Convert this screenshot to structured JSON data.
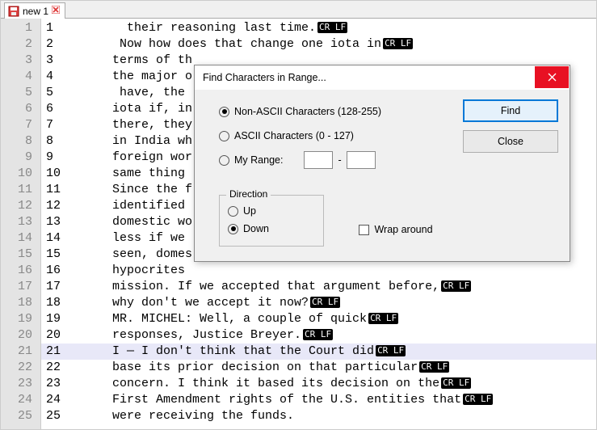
{
  "tab": {
    "title": "new 1"
  },
  "editor": {
    "eol_label": "CR LF",
    "highlight_index": 20,
    "lines": [
      {
        "n": 1,
        "c2": "1",
        "t": "    their reasoning last time.",
        "eol": true
      },
      {
        "n": 2,
        "c2": "2",
        "t": "   Now how does that change one iota in",
        "eol": true
      },
      {
        "n": 3,
        "c2": "3",
        "t": "  terms of th",
        "eol": false
      },
      {
        "n": 4,
        "c2": "4",
        "t": "  the major o",
        "eol": false
      },
      {
        "n": 5,
        "c2": "5",
        "t": "   have, the ",
        "eol": false
      },
      {
        "n": 6,
        "c2": "6",
        "t": "  iota if, in",
        "eol": false
      },
      {
        "n": 7,
        "c2": "7",
        "t": "  there, they",
        "eol": false
      },
      {
        "n": 8,
        "c2": "8",
        "t": "  in India wh",
        "eol": false
      },
      {
        "n": 9,
        "c2": "9",
        "t": "  foreign wor",
        "eol": false
      },
      {
        "n": 10,
        "c2": "10",
        "t": "  same thing ",
        "eol": false
      },
      {
        "n": 11,
        "c2": "11",
        "t": "  Since the f",
        "eol": false
      },
      {
        "n": 12,
        "c2": "12",
        "t": "  identified ",
        "eol": false
      },
      {
        "n": 13,
        "c2": "13",
        "t": "  domestic wo",
        "eol": false
      },
      {
        "n": 14,
        "c2": "14",
        "t": "  less if we ",
        "eol": false
      },
      {
        "n": 15,
        "c2": "15",
        "t": "  seen, domes",
        "eol": false
      },
      {
        "n": 16,
        "c2": "16",
        "t": "  hypocrites ",
        "eol": false
      },
      {
        "n": 17,
        "c2": "17",
        "t": "  mission. If we accepted that argument before,",
        "eol": true
      },
      {
        "n": 18,
        "c2": "18",
        "t": "  why don't we accept it now?",
        "eol": true
      },
      {
        "n": 19,
        "c2": "19",
        "t": "  MR. MICHEL: Well, a couple of quick",
        "eol": true
      },
      {
        "n": 20,
        "c2": "20",
        "t": "  responses, Justice Breyer.",
        "eol": true
      },
      {
        "n": 21,
        "c2": "21",
        "t": "  I — I don't think that the Court did",
        "eol": true
      },
      {
        "n": 22,
        "c2": "22",
        "t": "  base its prior decision on that particular",
        "eol": true
      },
      {
        "n": 23,
        "c2": "23",
        "t": "  concern. I think it based its decision on the",
        "eol": true
      },
      {
        "n": 24,
        "c2": "24",
        "t": "  First Amendment rights of the U.S. entities that",
        "eol": true
      },
      {
        "n": 25,
        "c2": "25",
        "t": "  were receiving the funds.",
        "eol": false
      }
    ]
  },
  "dialog": {
    "title": "Find Characters in Range...",
    "option_nonascii": "Non-ASCII Characters (128-255)",
    "option_ascii": "ASCII Characters (0 - 127)",
    "option_myrange": "My Range:",
    "range_sep": "-",
    "direction_legend": "Direction",
    "dir_up": "Up",
    "dir_down": "Down",
    "wrap": "Wrap around",
    "find": "Find",
    "close": "Close",
    "range_from": "",
    "range_to": ""
  }
}
